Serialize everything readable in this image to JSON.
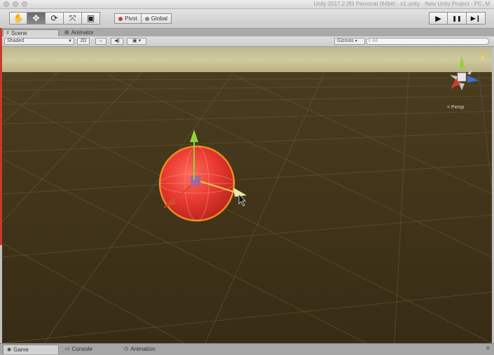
{
  "window": {
    "title": "Unity 2017.2.0f3 Personal (64bit) - s1.unity - New Unity Project - PC, M"
  },
  "toolbar": {
    "tools": [
      {
        "name": "hand-tool",
        "glyph": "✋"
      },
      {
        "name": "move-tool",
        "glyph": "✥"
      },
      {
        "name": "rotate-tool",
        "glyph": "⟳"
      },
      {
        "name": "scale-tool",
        "glyph": "⤧"
      },
      {
        "name": "rect-tool",
        "glyph": "▣"
      }
    ],
    "pivot_label": "Pivot",
    "global_label": "Global",
    "play_glyph": "▶",
    "pause_glyph": "❚❚",
    "step_glyph": "▶❙"
  },
  "tabs": {
    "scene": "Scene",
    "animator": "Animator"
  },
  "scene_toolbar": {
    "shading_mode": "Shaded",
    "mode_2d": "2D",
    "gizmos": "Gizmos",
    "search_placeholder": "All"
  },
  "gizmo": {
    "label": "< Persp"
  },
  "bottom_tabs": {
    "game": "Game",
    "console": "Console",
    "animation": "Animation"
  },
  "colors": {
    "sphere": "#e53a37",
    "selection_outline": "#f08a1e",
    "ground": "#3b3018",
    "sky": "#c9c29a",
    "axis_x": "#d03a2c",
    "axis_y": "#8fd33a",
    "axis_z": "#3a6fd3"
  }
}
